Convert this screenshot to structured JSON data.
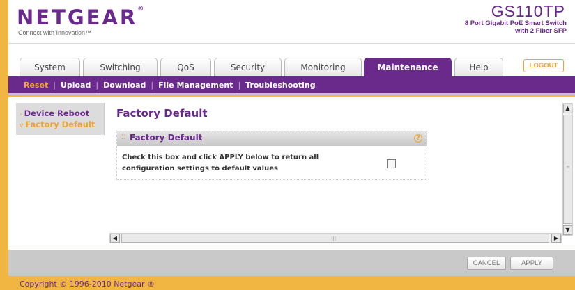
{
  "header": {
    "logo": "NETGEAR",
    "logo_mark": "®",
    "tagline": "Connect with Innovation™",
    "model": "GS110TP",
    "model_desc_line1": "8 Port Gigabit PoE Smart Switch",
    "model_desc_line2": "with 2 Fiber SFP"
  },
  "tabs": [
    {
      "label": "System"
    },
    {
      "label": "Switching"
    },
    {
      "label": "QoS"
    },
    {
      "label": "Security"
    },
    {
      "label": "Monitoring"
    },
    {
      "label": "Maintenance"
    },
    {
      "label": "Help"
    }
  ],
  "logout_label": "LOGOUT",
  "subnav": [
    "Reset",
    "Upload",
    "Download",
    "File Management",
    "Troubleshooting"
  ],
  "sidebar": {
    "items": [
      {
        "label": "Device Reboot"
      },
      {
        "label": "Factory Default"
      }
    ]
  },
  "main": {
    "title": "Factory Default",
    "panel": {
      "title": "Factory Default",
      "text": "Check this box and click APPLY below to return all configuration settings to default values"
    }
  },
  "footer": {
    "cancel_label": "CANCEL",
    "apply_label": "APPLY",
    "copyright": "Copyright © 1996-2010 Netgear ®"
  },
  "colors": {
    "brand_purple": "#6a2a8c",
    "accent_orange": "#f1a42a",
    "frame": "#f1b642"
  }
}
